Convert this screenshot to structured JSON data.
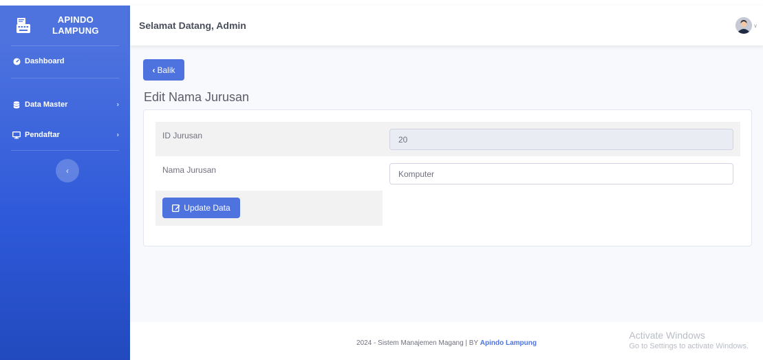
{
  "brand": {
    "line1": "APINDO",
    "line2": "LAMPUNG",
    "logo_icon": "typewriter-icon"
  },
  "sidebar": {
    "items": [
      {
        "label": "Dashboard",
        "icon": "tachometer-icon",
        "has_chevron": false
      },
      {
        "label": "Data Master",
        "icon": "database-icon",
        "has_chevron": true
      },
      {
        "label": "Pendaftar",
        "icon": "desktop-icon",
        "has_chevron": true
      }
    ],
    "toggle_icon": "chevron-left-icon"
  },
  "topbar": {
    "greeting": "Selamat Datang, Admin",
    "avatar_icon": "user-avatar-icon"
  },
  "main": {
    "back_button": "Balik",
    "page_title": "Edit Nama Jurusan",
    "form": {
      "id_label": "ID Jurusan",
      "id_value": "20",
      "name_label": "Nama Jurusan",
      "name_value": "Komputer",
      "submit_label": "Update Data"
    }
  },
  "footer": {
    "text": "2024 - Sistem Manajemen Magang | BY ",
    "brand_link": "Apindo Lampung"
  },
  "watermark": {
    "line1": "Activate Windows",
    "line2": "Go to Settings to activate Windows."
  },
  "colors": {
    "primary": "#4e73df",
    "sidebar_dark": "#224abe",
    "background": "#f8f9fc"
  }
}
